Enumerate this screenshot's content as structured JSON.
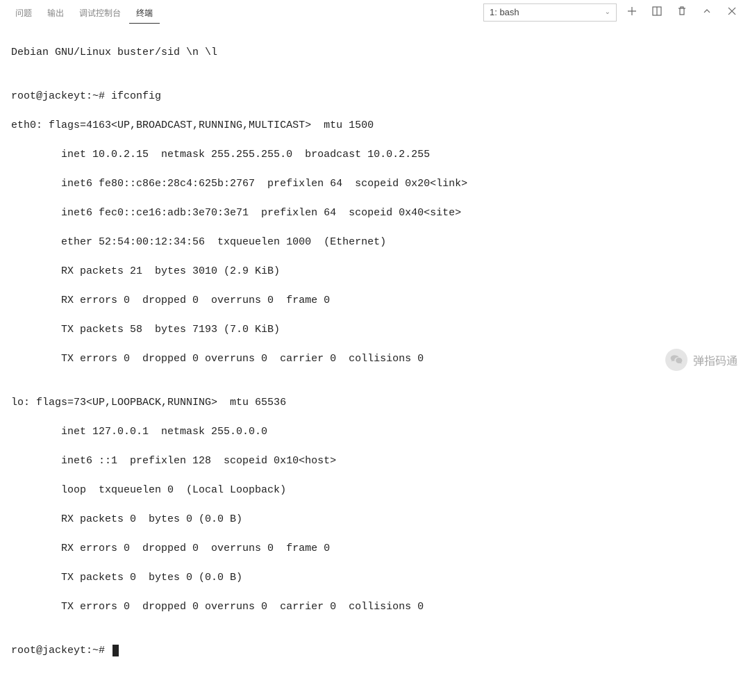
{
  "tabs": {
    "problems": "问题",
    "output": "输出",
    "debug_console": "调试控制台",
    "terminal": "终端"
  },
  "terminal_selector": {
    "selected": "1: bash"
  },
  "terminal": {
    "banner": "Debian GNU/Linux buster/sid \\n \\l",
    "blank1": "",
    "prompt1": "root@jackeyt:~# ifconfig",
    "eth0_l1": "eth0: flags=4163<UP,BROADCAST,RUNNING,MULTICAST>  mtu 1500",
    "eth0_l2": "        inet 10.0.2.15  netmask 255.255.255.0  broadcast 10.0.2.255",
    "eth0_l3": "        inet6 fe80::c86e:28c4:625b:2767  prefixlen 64  scopeid 0x20<link>",
    "eth0_l4": "        inet6 fec0::ce16:adb:3e70:3e71  prefixlen 64  scopeid 0x40<site>",
    "eth0_l5": "        ether 52:54:00:12:34:56  txqueuelen 1000  (Ethernet)",
    "eth0_l6": "        RX packets 21  bytes 3010 (2.9 KiB)",
    "eth0_l7": "        RX errors 0  dropped 0  overruns 0  frame 0",
    "eth0_l8": "        TX packets 58  bytes 7193 (7.0 KiB)",
    "eth0_l9": "        TX errors 0  dropped 0 overruns 0  carrier 0  collisions 0",
    "blank2": "",
    "lo_l1": "lo: flags=73<UP,LOOPBACK,RUNNING>  mtu 65536",
    "lo_l2": "        inet 127.0.0.1  netmask 255.0.0.0",
    "lo_l3": "        inet6 ::1  prefixlen 128  scopeid 0x10<host>",
    "lo_l4": "        loop  txqueuelen 0  (Local Loopback)",
    "lo_l5": "        RX packets 0  bytes 0 (0.0 B)",
    "lo_l6": "        RX errors 0  dropped 0  overruns 0  frame 0",
    "lo_l7": "        TX packets 0  bytes 0 (0.0 B)",
    "lo_l8": "        TX errors 0  dropped 0 overruns 0  carrier 0  collisions 0",
    "blank3": "",
    "prompt2": "root@jackeyt:~# "
  },
  "watermark": {
    "text": "弹指码通"
  }
}
